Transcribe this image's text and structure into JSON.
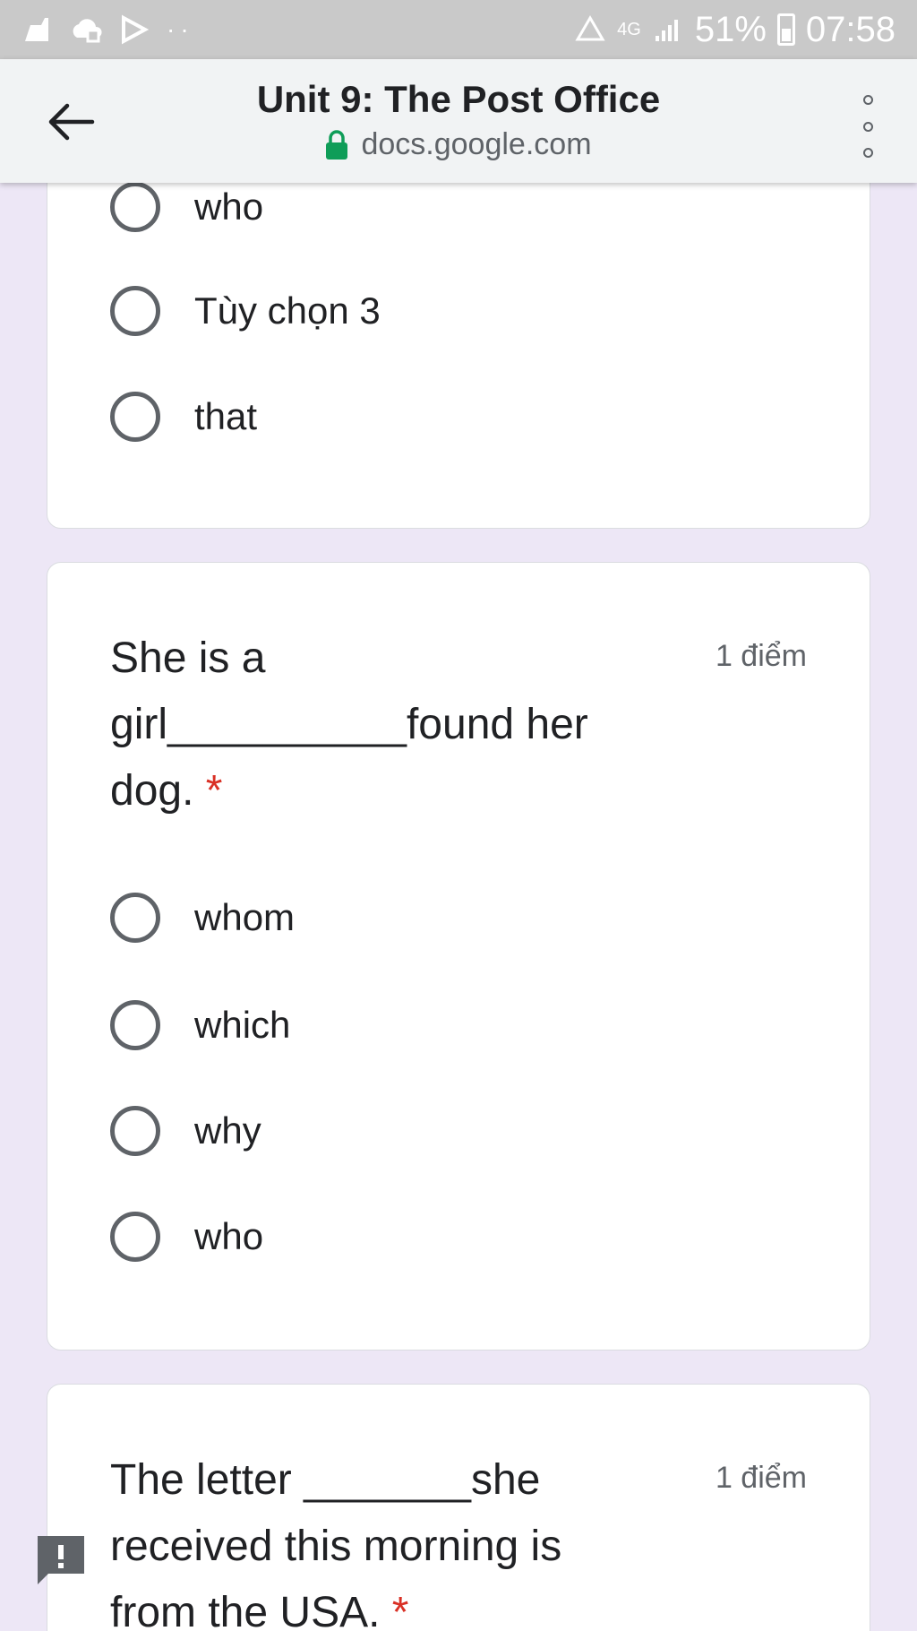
{
  "status_bar": {
    "battery": "51%",
    "time": "07:58",
    "network": "4G",
    "colors": {
      "background": "#c9c9c9"
    }
  },
  "toolbar": {
    "title": "Unit 9: The Post Office",
    "url": "docs.google.com",
    "lock_color": "#0f9d58"
  },
  "question_1": {
    "options": [
      "who",
      "Tùy chọn 3",
      "that"
    ]
  },
  "question_2": {
    "text": "She is a girl__________found her dog.",
    "required_marker": "*",
    "points": "1 điểm",
    "options": [
      "whom",
      "which",
      "why",
      "who"
    ]
  },
  "question_3": {
    "text": "The letter _______she received this morning is from the USA.",
    "required_marker": "*",
    "points": "1 điểm"
  },
  "theme": {
    "page_background": "#ede7f6",
    "required_color": "#d93025"
  }
}
